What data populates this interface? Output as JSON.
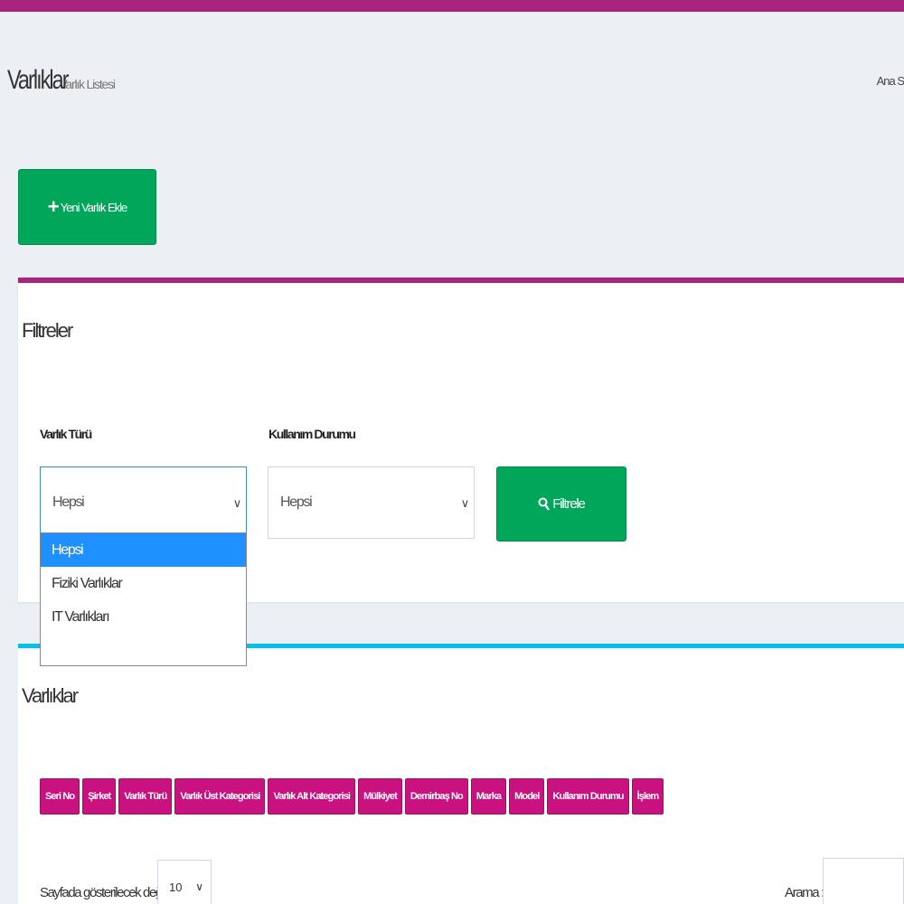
{
  "header": {
    "title": "Varlıklar",
    "subtitle": "Varlık Listesi",
    "breadcrumb": "Ana S"
  },
  "actions": {
    "add_label": "Yeni Varlık Ekle",
    "add_icon": "plus-icon"
  },
  "filters": {
    "title": "Filtreler",
    "asset_type": {
      "label": "Varlık Türü",
      "value": "Hepsi",
      "options": [
        "Hepsi",
        "Fiziki Varlıklar",
        "IT Varlıkları"
      ],
      "selected_index": 0,
      "expanded": true
    },
    "usage_status": {
      "label": "Kullanım Durumu",
      "value": "Hepsi"
    },
    "filter_button": "Filtrele",
    "filter_icon": "search-icon"
  },
  "assets": {
    "title": "Varlıklar",
    "columns": [
      "Seri No",
      "Şirket",
      "Varlık Türü",
      "Varlık Üst Kategorisi",
      "Varlık Alt Kategorisi",
      "Mülkiyet",
      "Demirbaş No",
      "Marka",
      "Model",
      "Kullanım Durumu",
      "İşlem"
    ],
    "page_size_label": "Sayfada gösterilecek değer",
    "page_size": "10",
    "search_label": "Arama :",
    "search_value": ""
  },
  "colors": {
    "brand": "#a8247f",
    "success": "#00a65a",
    "info": "#00c0ef",
    "column_button": "#c9127f",
    "selected_option": "#1e90ff"
  }
}
